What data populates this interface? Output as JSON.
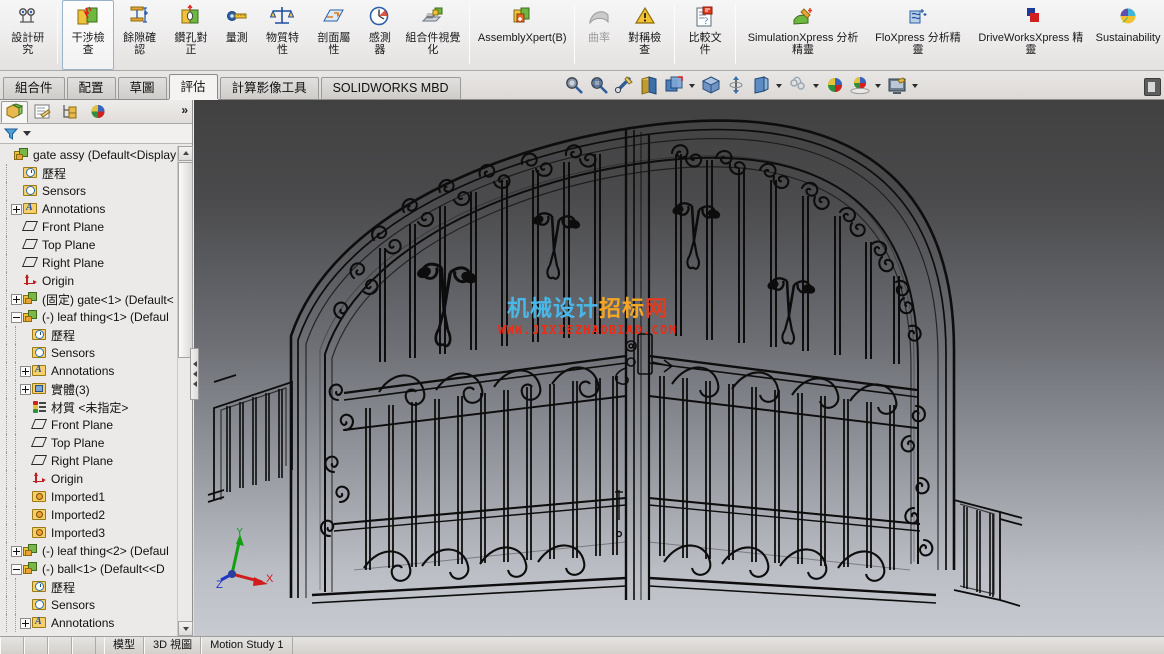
{
  "ribbon": {
    "commands": [
      {
        "label": "設計研究",
        "icon": "design-study-icon",
        "state": "normal"
      },
      {
        "sep": true
      },
      {
        "label": "干涉檢查",
        "icon": "interference-detection-icon",
        "state": "selected"
      },
      {
        "label": "餘隙確認",
        "icon": "clearance-verification-icon",
        "state": "normal"
      },
      {
        "label": "鑽孔對正",
        "icon": "hole-alignment-icon",
        "state": "normal"
      },
      {
        "label": "量測",
        "icon": "measure-icon",
        "state": "normal"
      },
      {
        "label": "物質特性",
        "icon": "mass-properties-icon",
        "state": "normal"
      },
      {
        "label": "剖面屬性",
        "icon": "section-properties-icon",
        "state": "normal"
      },
      {
        "label": "感測器",
        "icon": "sensor-icon",
        "state": "normal"
      },
      {
        "label": "組合件視覺化",
        "icon": "assembly-visualization-icon",
        "state": "normal"
      },
      {
        "sep": true
      },
      {
        "label": "AssemblyXpert(B)",
        "icon": "assemblyxpert-icon",
        "state": "normal",
        "wide": true
      },
      {
        "sep": true
      },
      {
        "label": "曲率",
        "icon": "curvature-icon",
        "state": "disabled"
      },
      {
        "label": "對稱檢查",
        "icon": "symmetry-check-icon",
        "state": "normal"
      },
      {
        "sep": true
      },
      {
        "label": "比較文件",
        "icon": "compare-documents-icon",
        "state": "normal"
      },
      {
        "sep": true
      },
      {
        "label": "SimulationXpress 分析精靈",
        "icon": "simulationxpress-icon",
        "state": "normal",
        "wide": true
      },
      {
        "label": "FloXpress 分析精靈",
        "icon": "floxpress-icon",
        "state": "normal",
        "wide": true
      },
      {
        "label": "DriveWorksXpress 精靈",
        "icon": "driveworksxpress-icon",
        "state": "normal",
        "wide": true
      },
      {
        "label": "Sustainability",
        "icon": "sustainability-icon",
        "state": "normal",
        "wide": true
      }
    ]
  },
  "tabs": {
    "items": [
      {
        "label": "組合件",
        "active": false
      },
      {
        "label": "配置",
        "active": false
      },
      {
        "label": "草圖",
        "active": false
      },
      {
        "label": "評估",
        "active": true
      },
      {
        "label": "計算影像工具",
        "active": false
      },
      {
        "label": "SOLIDWORKS MBD",
        "active": false
      }
    ],
    "view_tools": [
      {
        "icon": "zoom-to-fit-icon"
      },
      {
        "icon": "zoom-to-area-icon"
      },
      {
        "icon": "previous-view-icon"
      },
      {
        "icon": "section-view-icon"
      },
      {
        "icon": "view-orientation-icon",
        "caret": true
      },
      {
        "icon": "display-style-icon"
      },
      {
        "icon": "hide-show-items-icon"
      },
      {
        "icon": "edit-appearance-icon",
        "caret": true
      },
      {
        "icon": "apply-scene-icon",
        "caret": true
      },
      {
        "icon": "view-settings-icon",
        "caret": true
      }
    ],
    "right_dock_icon": "display-pane-icon"
  },
  "left_panel": {
    "panel_tabs": [
      {
        "icon": "feature-manager-tab-icon",
        "active": true
      },
      {
        "icon": "property-manager-tab-icon",
        "active": false
      },
      {
        "icon": "configuration-manager-tab-icon",
        "active": false
      },
      {
        "icon": "display-manager-tab-icon",
        "active": false
      }
    ],
    "more_glyph": "»",
    "filter_icon": "filter-icon",
    "tree": [
      {
        "depth": 0,
        "toggle": "none",
        "icon": "assembly-icon",
        "label": "gate assy  (Default<Display",
        "root": true
      },
      {
        "depth": 1,
        "toggle": "none",
        "icon": "history-icon",
        "label": "歷程"
      },
      {
        "depth": 1,
        "toggle": "none",
        "icon": "sensors-icon",
        "label": "Sensors"
      },
      {
        "depth": 1,
        "toggle": "plus",
        "icon": "annotations-icon",
        "label": "Annotations"
      },
      {
        "depth": 1,
        "toggle": "none",
        "icon": "plane-icon",
        "label": "Front Plane"
      },
      {
        "depth": 1,
        "toggle": "none",
        "icon": "plane-icon",
        "label": "Top Plane"
      },
      {
        "depth": 1,
        "toggle": "none",
        "icon": "plane-icon",
        "label": "Right Plane"
      },
      {
        "depth": 1,
        "toggle": "none",
        "icon": "origin-icon",
        "label": "Origin"
      },
      {
        "depth": 1,
        "toggle": "plus",
        "icon": "component-icon",
        "label": "(固定) gate<1> (Default<"
      },
      {
        "depth": 1,
        "toggle": "minus",
        "icon": "component-icon",
        "label": "(-) leaf thing<1> (Defaul"
      },
      {
        "depth": 2,
        "toggle": "none",
        "icon": "history-icon",
        "label": "歷程"
      },
      {
        "depth": 2,
        "toggle": "none",
        "icon": "sensors-icon",
        "label": "Sensors"
      },
      {
        "depth": 2,
        "toggle": "plus",
        "icon": "annotations-icon",
        "label": "Annotations"
      },
      {
        "depth": 2,
        "toggle": "plus",
        "icon": "solid-bodies-icon",
        "label": "實體(3)"
      },
      {
        "depth": 2,
        "toggle": "none",
        "icon": "material-icon",
        "label": "材質 <未指定>"
      },
      {
        "depth": 2,
        "toggle": "none",
        "icon": "plane-icon",
        "label": "Front Plane"
      },
      {
        "depth": 2,
        "toggle": "none",
        "icon": "plane-icon",
        "label": "Top Plane"
      },
      {
        "depth": 2,
        "toggle": "none",
        "icon": "plane-icon",
        "label": "Right Plane"
      },
      {
        "depth": 2,
        "toggle": "none",
        "icon": "origin-icon",
        "label": "Origin"
      },
      {
        "depth": 2,
        "toggle": "none",
        "icon": "imported-icon",
        "label": "Imported1"
      },
      {
        "depth": 2,
        "toggle": "none",
        "icon": "imported-icon",
        "label": "Imported2"
      },
      {
        "depth": 2,
        "toggle": "none",
        "icon": "imported-icon",
        "label": "Imported3"
      },
      {
        "depth": 1,
        "toggle": "plus",
        "icon": "component-icon",
        "label": "(-) leaf thing<2> (Defaul"
      },
      {
        "depth": 1,
        "toggle": "minus",
        "icon": "component-icon",
        "label": "(-) ball<1> (Default<<D"
      },
      {
        "depth": 2,
        "toggle": "none",
        "icon": "history-icon",
        "label": "歷程"
      },
      {
        "depth": 2,
        "toggle": "none",
        "icon": "sensors-icon",
        "label": "Sensors"
      },
      {
        "depth": 2,
        "toggle": "plus",
        "icon": "annotations-icon",
        "label": "Annotations"
      }
    ]
  },
  "viewport": {
    "watermark_cn_parts": [
      {
        "text": "机械设计",
        "color": "blue"
      },
      {
        "text": "招标",
        "color": "orange"
      },
      {
        "text": "网",
        "color": "red"
      }
    ],
    "watermark_cn": "机械设计招标网",
    "watermark_url": "WWW.JIXIEZHAOBIAO.COM",
    "background_top_color": "#414141",
    "background_bottom_color": "#c8cad1",
    "triad": {
      "x_label": "X",
      "y_label": "Y",
      "z_label": "Z",
      "x_color": "#d01c1c",
      "y_color": "#12a012",
      "z_color": "#1f35c8"
    },
    "model_name": "gate assy"
  },
  "statusbar": {
    "items": [
      {
        "label": "模型",
        "type": "tab"
      },
      {
        "label": "3D 視圖",
        "type": "tab"
      },
      {
        "label": "Motion Study 1",
        "type": "tab"
      }
    ]
  }
}
